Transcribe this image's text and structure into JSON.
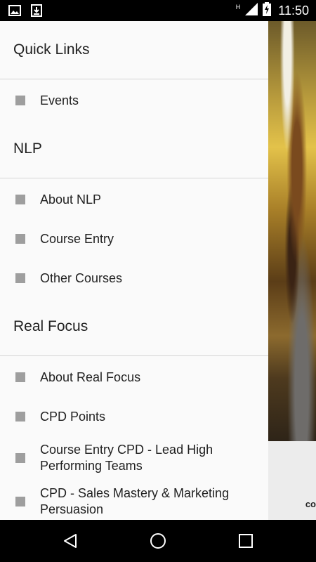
{
  "status_bar": {
    "time": "11:50",
    "network_indicator": "H",
    "icons": [
      "image-notification-icon",
      "download-notification-icon",
      "signal-icon",
      "battery-charging-icon"
    ]
  },
  "drawer": {
    "sections": [
      {
        "title": "Quick Links",
        "items": [
          {
            "label": "Events"
          }
        ]
      },
      {
        "title": "NLP",
        "items": [
          {
            "label": "About NLP"
          },
          {
            "label": "Course Entry"
          },
          {
            "label": "Other Courses"
          }
        ]
      },
      {
        "title": "Real Focus",
        "items": [
          {
            "label": "About Real Focus"
          },
          {
            "label": "CPD Points"
          },
          {
            "label": "Course Entry CPD - Lead High Performing Teams"
          },
          {
            "label": "CPD - Sales Mastery & Marketing Persuasion"
          }
        ]
      }
    ]
  },
  "background": {
    "caption_fragment": "co"
  },
  "nav_bar": {
    "icons": [
      "back-icon",
      "home-icon",
      "recents-icon"
    ]
  },
  "colors": {
    "drawer_bg": "#fafafa",
    "bullet": "#9e9e9e",
    "divider": "#d4d4d4",
    "system_bars": "#000000"
  }
}
